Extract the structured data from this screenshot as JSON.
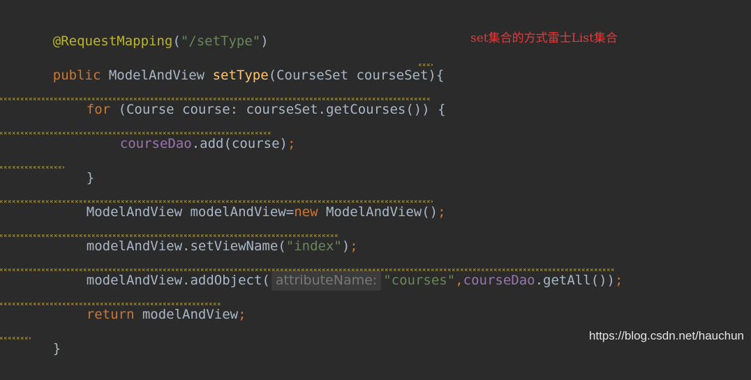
{
  "code": {
    "line1": {
      "annotation": "@RequestMapping",
      "open": "(",
      "string": "\"/setType\"",
      "close": ")"
    },
    "line2": {
      "modifier": "public ",
      "type": "ModelAndView ",
      "method": "setType",
      "params": "(CourseSet courseSet)",
      "brace": "{"
    },
    "line3": {
      "keyword": "for",
      "rest": " (Course course: courseSet.getCourses()) {"
    },
    "line4": {
      "field": "courseDao",
      "rest": ".add(course)",
      "semi": ";"
    },
    "line5": {
      "text": "}"
    },
    "line6": {
      "left": "ModelAndView modelAndView=",
      "keyword": "new",
      "right": " ModelAndView()",
      "semi": ";"
    },
    "line7": {
      "left": "modelAndView.setViewName(",
      "string": "\"index\"",
      "right": ")",
      "semi": ";"
    },
    "line8": {
      "left": "modelAndView.addObject(",
      "hint": "attributeName:",
      "string": "\"courses\"",
      "comma": ",",
      "field": "courseDao",
      "right": ".getAll())",
      "semi": ";"
    },
    "line9": {
      "keyword": "return",
      "rest": " modelAndView",
      "semi": ";"
    },
    "line10": {
      "text": "}"
    }
  },
  "annotation_note": "set集合的方式雷士List集合",
  "watermark": "https://blog.csdn.net/hauchun",
  "colors": {
    "background": "#2b2b2b",
    "annotation": "#bbb529",
    "string": "#6a8759",
    "keyword": "#cc7832",
    "method": "#ffc66d",
    "field": "#9876aa",
    "default": "#a9b7c6",
    "note": "#e03c3c"
  }
}
